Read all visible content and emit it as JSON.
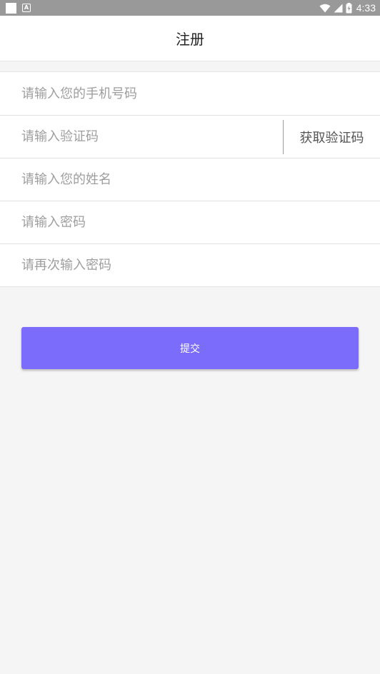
{
  "status_bar": {
    "time": "4:33",
    "icons": [
      "notification-square-icon",
      "app-a-icon",
      "wifi-icon",
      "signal-icon",
      "battery-charging-icon"
    ]
  },
  "header": {
    "title": "注册"
  },
  "form": {
    "phone": {
      "placeholder": "请输入您的手机号码",
      "value": ""
    },
    "code": {
      "placeholder": "请输入验证码",
      "value": "",
      "button_label": "获取验证码"
    },
    "name": {
      "placeholder": "请输入您的姓名",
      "value": ""
    },
    "password": {
      "placeholder": "请输入密码",
      "value": ""
    },
    "password_confirm": {
      "placeholder": "请再次输入密码",
      "value": ""
    }
  },
  "submit": {
    "label": "提交"
  },
  "colors": {
    "accent": "#7b6cfb",
    "status_bar": "#999999",
    "background": "#f5f5f5"
  }
}
